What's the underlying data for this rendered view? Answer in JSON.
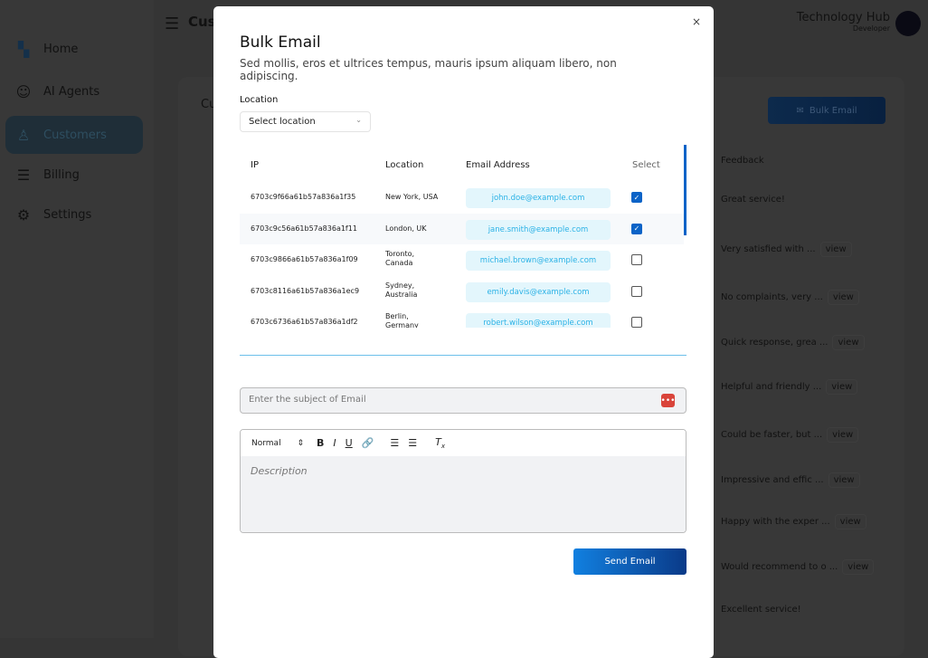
{
  "sidebar": {
    "items": [
      {
        "label": "Home",
        "icon": "home-grid-icon"
      },
      {
        "label": "AI Agents",
        "icon": "robot-icon"
      },
      {
        "label": "Customers",
        "icon": "user-icon",
        "active": true
      },
      {
        "label": "Billing",
        "icon": "receipt-icon"
      },
      {
        "label": "Settings",
        "icon": "gear-icon"
      }
    ]
  },
  "header": {
    "title": "Customers",
    "user_name": "Technology Hub",
    "user_role": "Developer"
  },
  "card": {
    "title": "Customers",
    "bulk_email": "Bulk Email",
    "feedback_header": "Feedback",
    "view_label": "view",
    "feedback": [
      {
        "text": "Great service!",
        "view": false
      },
      {
        "text": "Very satisfied with ...",
        "view": true
      },
      {
        "text": "No complaints, very ...",
        "view": true
      },
      {
        "text": "Quick response, grea ...",
        "view": true
      },
      {
        "text": "Helpful and friendly ...",
        "view": true
      },
      {
        "text": "Could be faster, but ...",
        "view": true
      },
      {
        "text": "Impressive and effic ...",
        "view": true
      },
      {
        "text": "Happy with the exper ...",
        "view": true
      },
      {
        "text": "Would recommend to o ...",
        "view": true
      },
      {
        "text": "Excellent service!",
        "view": false
      }
    ]
  },
  "modal": {
    "title": "Bulk Email",
    "subtitle": "Sed mollis, eros et ultrices tempus, mauris ipsum aliquam libero, non adipiscing.",
    "close": "×",
    "location_label": "Location",
    "location_placeholder": "Select location",
    "columns": [
      "IP",
      "Location",
      "Email Address",
      "Select"
    ],
    "rows": [
      {
        "ip": "6703c9f66a61b57a836a1f35",
        "location": "New York, USA",
        "email": "john.doe@example.com",
        "selected": true
      },
      {
        "ip": "6703c9c56a61b57a836a1f11",
        "location": "London, UK",
        "email": "jane.smith@example.com",
        "selected": true
      },
      {
        "ip": "6703c9866a61b57a836a1f09",
        "location": "Toronto, Canada",
        "email": "michael.brown@example.com",
        "selected": false
      },
      {
        "ip": "6703c8116a61b57a836a1ec9",
        "location": "Sydney, Australia",
        "email": "emily.davis@example.com",
        "selected": false
      },
      {
        "ip": "6703c6736a61b57a836a1df2",
        "location": "Berlin, Germany",
        "email": "robert.wilson@example.com",
        "selected": false
      }
    ],
    "subject_placeholder": "Enter the subject of Email",
    "format_select": "Normal",
    "description_placeholder": "Description",
    "send_label": "Send Email"
  },
  "colors": {
    "accent": "#0b63c7",
    "email_text": "#2bb2e6",
    "email_bg": "#e3f6fc"
  }
}
